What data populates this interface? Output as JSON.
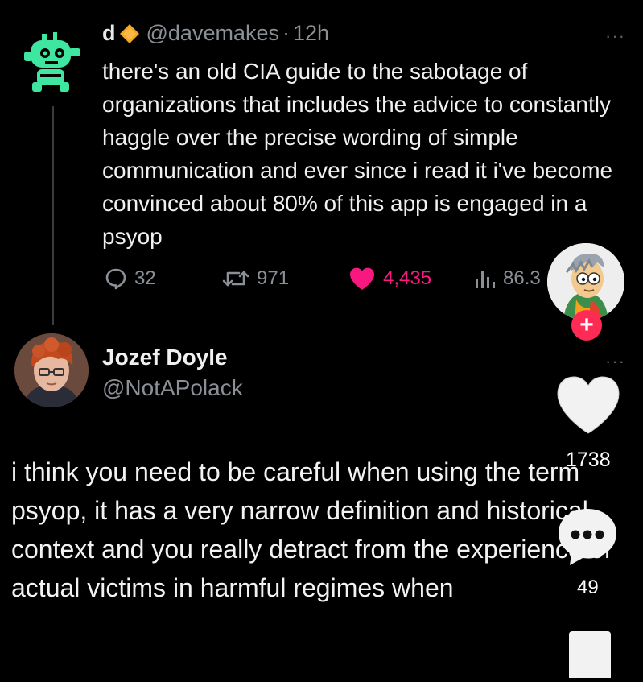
{
  "tweet": {
    "author_name": "d",
    "handle": "@davemakes",
    "separator": "·",
    "time": "12h",
    "text": "there's an old CIA guide to the sabotage of organizations that includes the advice to constantly haggle over the precise wording of simple communication and ever since i read it i've become convinced about 80% of this app is engaged in a psyop",
    "more": "···",
    "stats": {
      "replies": "32",
      "retweets": "971",
      "likes": "4,435",
      "views": "86.3"
    }
  },
  "reply": {
    "author_name": "Jozef Doyle",
    "handle": "@NotAPolack",
    "more": "···",
    "text": "i think you need to be careful when using the term psyop, it has a very narrow definition and historical context and you really detract from the experience of actual victims in harmful regimes when"
  },
  "overlay": {
    "follow_symbol": "+",
    "like_count": "1738",
    "comment_count": "49"
  },
  "colors": {
    "background": "#000000",
    "like_pink": "#f91880",
    "follow_red": "#fe2c55",
    "muted_text": "#8b9096",
    "avatar_green": "#3ee6a0"
  },
  "icons": {
    "badge": "gold-diamond-icon",
    "reply": "speech-bubble-icon",
    "retweet": "retweet-icon",
    "like": "heart-icon",
    "views": "bar-chart-icon",
    "overlay_like": "heart-icon",
    "overlay_comment": "comment-bubble-icon",
    "overlay_bookmark": "bookmark-icon"
  }
}
